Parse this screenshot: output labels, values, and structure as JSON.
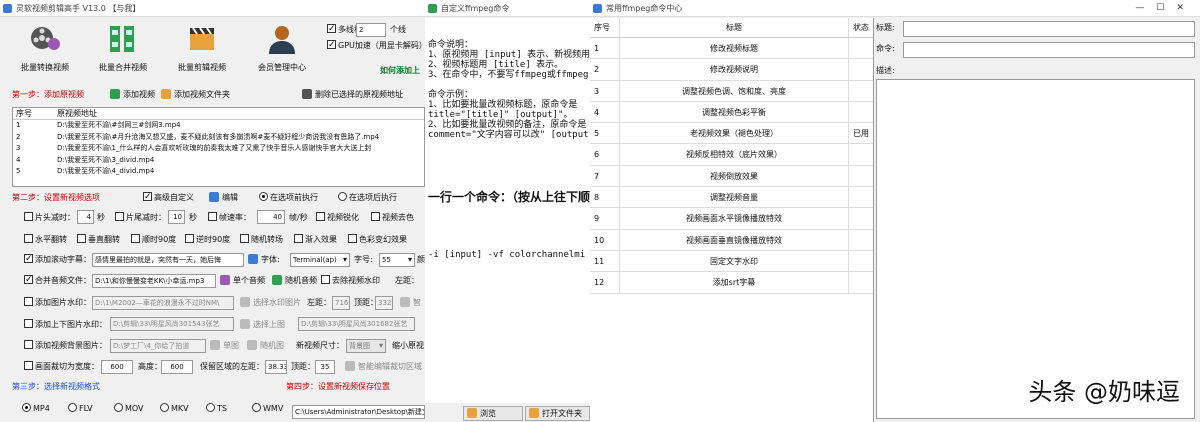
{
  "win1": {
    "title": "灵软视频剪辑高手 V13.0  【与我】",
    "toolbar": [
      "批量转换视频",
      "批量合并视频",
      "批量剪辑视频",
      "会员管理中心"
    ],
    "multithread_label": "多线程",
    "thread_count": "2",
    "thread_suffix": "个线",
    "gpu_label": "GPU加速（用显卡解码）",
    "howto_link": "如何添加上",
    "step1": "第一步：添加原视频",
    "add_video": "添加视频",
    "add_folder": "添加视频文件夹",
    "delete_selected": "删除已选择的原视频地址",
    "list_headers": [
      "序号",
      "原视频地址"
    ],
    "files": [
      {
        "idx": "1",
        "path": "D:\\我爱至死不渝\\#剑网三#剑网3.mp4"
      },
      {
        "idx": "2",
        "path": "D:\\我爱至死不渝\\#月升沧海又想又盛，麦不疑此刻该有多崩溃啊#麦不疑好程少商说我没有恩路了.mp4"
      },
      {
        "idx": "3",
        "path": "D:\\我爱至死不渝\\1_什么样的人会喜欢听玫瑰的前奏我太难了又熏了快手音乐人感谢快手官大大送上封"
      },
      {
        "idx": "4",
        "path": "D:\\我爱至死不渝\\3_divid.mp4"
      },
      {
        "idx": "5",
        "path": "D:\\我爱至死不渝\\4_divid.mp4"
      }
    ],
    "step2": "第二步：设置新视频选项",
    "advanced": "高级自定义",
    "edit": "编辑",
    "exec_before": "在选项前执行",
    "exec_after": "在选项后执行",
    "head_cut": "片头减时：",
    "head_val": "4",
    "sec": "秒",
    "tail_cut": "片尾减时：",
    "tail_val": "10",
    "frame_rate": "帧速率：",
    "fr_val": "40",
    "fr_unit": "帧/秒",
    "sharpen": "视频锐化",
    "video_color": "视频去色",
    "hflip": "水平翻转",
    "vflip": "垂直翻转",
    "rot90": "顺时90度",
    "rot90r": "逆时90度",
    "rand_trans": "随机转场",
    "fade_in": "渐入效果",
    "color_flash": "色彩变幻效果",
    "scroll_sub": "添加滚动字幕：",
    "scroll_text": "感情里最拍的就是，突然有一天，她后悔",
    "font_label": "字体:",
    "font_val": "Terminal(ap)",
    "size_label": "字号:",
    "size_val": "55",
    "color_hint": "颜",
    "merge_audio": "合并音频文件：",
    "audio_path": "D:\\1\\和你慢慢变老KK\\小幸运.mp3",
    "single_audio": "单个音频",
    "rand_audio": "随机音频",
    "remove_watermark": "去除视频水印",
    "left_edge": "左距：",
    "img_watermark": "添加图片水印：",
    "img_path": "D:\\1\\M2002—車花的浪漫永不过时NM\\",
    "choose_img": "选择水印图片",
    "left_val": "716",
    "top_label": "顶距：",
    "top_val": "332",
    "smart": "智",
    "tb_watermark": "添加上下图片水印：",
    "tb_path1": "D:\\剪辑\\33\\明星风尚301543张艺",
    "top_img": "选择上图",
    "tb_path2": "D:\\剪辑\\33\\明星风尚301682张艺",
    "bg_img": "添加视频背景图片：",
    "bg_path": "D:\\梦工厂\\4_你给了拍道",
    "single_img": "单图",
    "rand_img": "随机图",
    "new_size": "新视频尺寸：",
    "size_sel": "背景图",
    "shrink": "缩小原视",
    "crop": "画面裁切为宽度：",
    "crop_w": "600",
    "height_label": "高度：",
    "crop_h": "600",
    "keep_left": "保留区域的左距：",
    "keep_left_val": "38.33",
    "keep_top": "顶距：",
    "keep_top_val": "35",
    "smart_crop": "智能编辑裁切区域",
    "step3": "第三步：选择新视频格式",
    "step4": "第四步：设置新视频保存位置",
    "formats": [
      "MP4",
      "FLV",
      "MOV",
      "MKV",
      "TS",
      "WMV"
    ],
    "save_path": "C:\\Users\\Administrator\\Desktop\\新建文件夹"
  },
  "win2": {
    "title": "自定义ffmpeg命令",
    "text_lines": [
      "命令说明：",
      "1、原视频用 [input] 表示、新视频用",
      "2、视频标题用 [title] 表示。",
      "3、在命令中，不要写ffmpeg或ffmpeg.",
      "",
      "命令示例：",
      "1、比如要批量改视频标题，原命令是",
      "title=\"[title]\" [output]\"。",
      "2、比如要批量改视频的备注，原命令是",
      "comment=\"文字内容可以改\" [output]。"
    ],
    "big_line": "一行一个命令：（按从上往下顺",
    "cmd_line": "-i [input] -vf colorchannelmi",
    "browse": "浏览",
    "open_folder": "打开文件夹"
  },
  "win3": {
    "title": "常用ffmpeg命令中心",
    "headers": [
      "序号",
      "标题",
      "状态"
    ],
    "rows": [
      {
        "n": "1",
        "t": "修改视频标题",
        "s": ""
      },
      {
        "n": "2",
        "t": "修改视频说明",
        "s": ""
      },
      {
        "n": "3",
        "t": "调整视频色调、饱和度、亮度",
        "s": ""
      },
      {
        "n": "4",
        "t": "调整视频色彩平衡",
        "s": ""
      },
      {
        "n": "5",
        "t": "老视频效果（褪色处理）",
        "s": "已用"
      },
      {
        "n": "6",
        "t": "视频反相特效（底片效果）",
        "s": ""
      },
      {
        "n": "7",
        "t": "视频倒放效果",
        "s": ""
      },
      {
        "n": "8",
        "t": "调整视频音量",
        "s": ""
      },
      {
        "n": "9",
        "t": "视频画面水平镜像播放特效",
        "s": ""
      },
      {
        "n": "10",
        "t": "视频画面垂直镜像播放特效",
        "s": ""
      },
      {
        "n": "11",
        "t": "固定文字水印",
        "s": ""
      },
      {
        "n": "12",
        "t": "添加srt字幕",
        "s": ""
      }
    ],
    "title_label": "标题:",
    "cmd_label": "命令:",
    "desc_label": "描述:"
  },
  "watermark": "头条 @奶味逗"
}
